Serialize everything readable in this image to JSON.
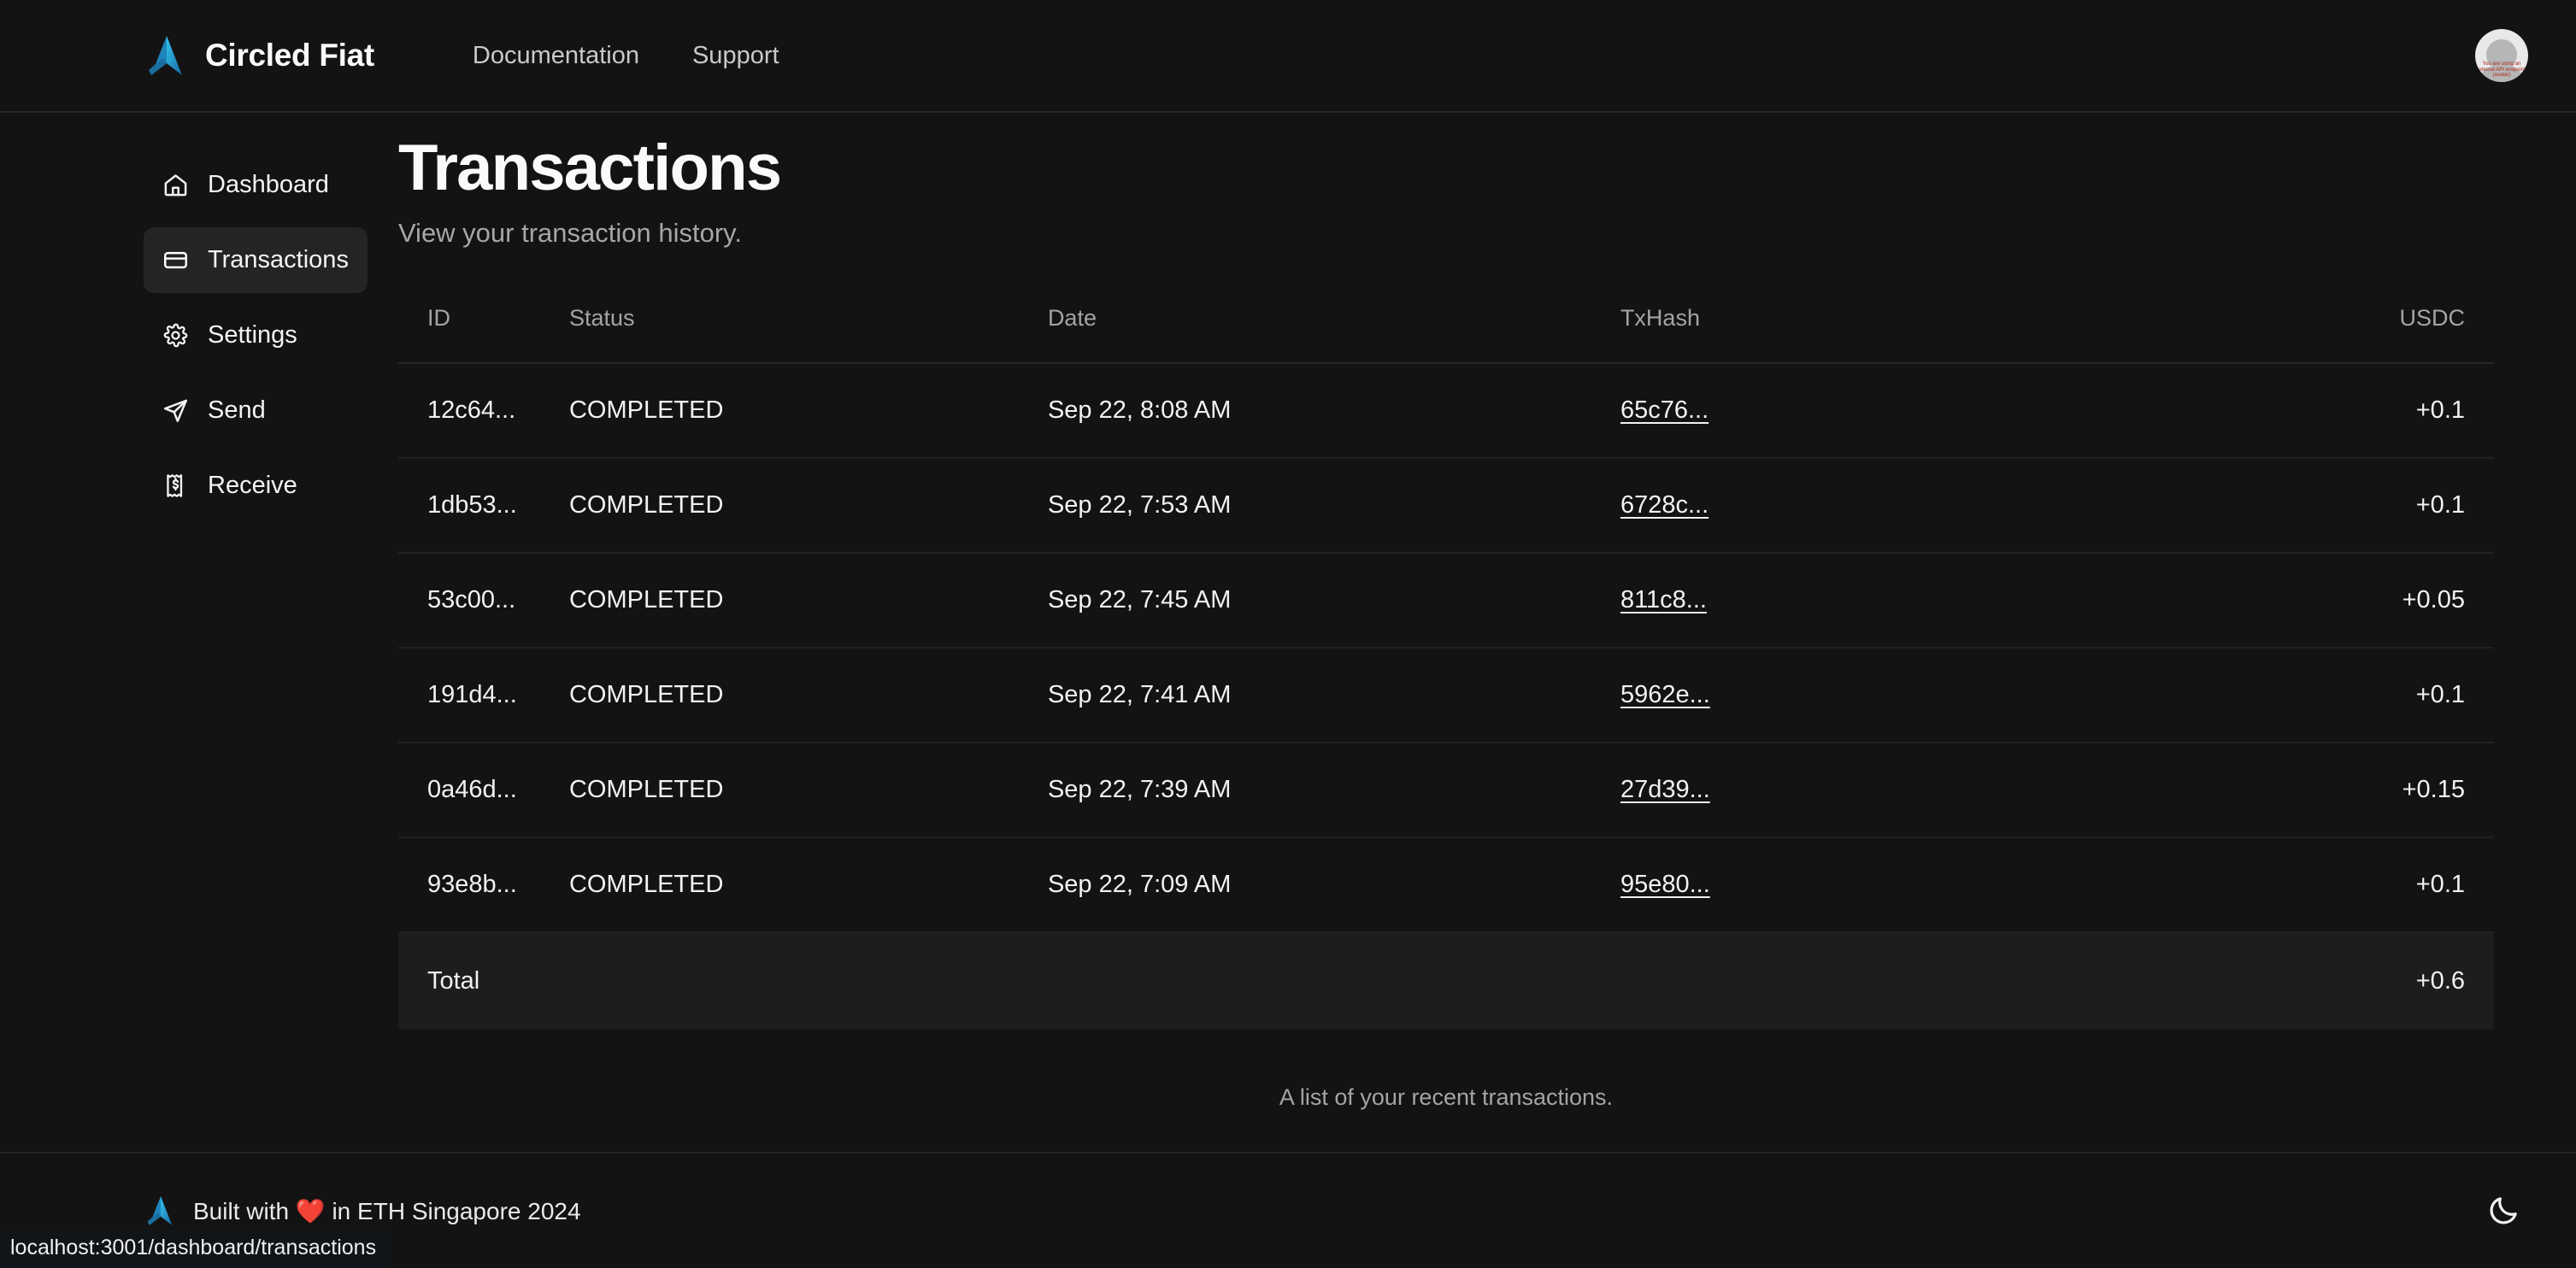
{
  "header": {
    "brand_name": "Circled Fiat",
    "logo_icon": "arrow-logo-icon",
    "nav": [
      {
        "label": "Documentation",
        "name": "nav-link-documentation"
      },
      {
        "label": "Support",
        "name": "nav-link-support"
      }
    ],
    "avatar": {
      "icon": "user-avatar-icon",
      "overlay_text": "You are using an external API endpoint. (avatar)"
    }
  },
  "sidebar": {
    "items": [
      {
        "label": "Dashboard",
        "icon": "home-icon",
        "active": false
      },
      {
        "label": "Transactions",
        "icon": "credit-card-icon",
        "active": true
      },
      {
        "label": "Settings",
        "icon": "gear-icon",
        "active": false
      },
      {
        "label": "Send",
        "icon": "send-icon",
        "active": false
      },
      {
        "label": "Receive",
        "icon": "receipt-icon",
        "active": false
      }
    ]
  },
  "main": {
    "title": "Transactions",
    "subtitle": "View your transaction history.",
    "table": {
      "columns": [
        "ID",
        "Status",
        "Date",
        "TxHash",
        "USDC"
      ],
      "rows": [
        {
          "id": "12c64...",
          "status": "COMPLETED",
          "date": "Sep 22, 8:08 AM",
          "txhash": "65c76...",
          "usdc": "+0.1"
        },
        {
          "id": "1db53...",
          "status": "COMPLETED",
          "date": "Sep 22, 7:53 AM",
          "txhash": "6728c...",
          "usdc": "+0.1"
        },
        {
          "id": "53c00...",
          "status": "COMPLETED",
          "date": "Sep 22, 7:45 AM",
          "txhash": "811c8...",
          "usdc": "+0.05"
        },
        {
          "id": "191d4...",
          "status": "COMPLETED",
          "date": "Sep 22, 7:41 AM",
          "txhash": "5962e...",
          "usdc": "+0.1"
        },
        {
          "id": "0a46d...",
          "status": "COMPLETED",
          "date": "Sep 22, 7:39 AM",
          "txhash": "27d39...",
          "usdc": "+0.15"
        },
        {
          "id": "93e8b...",
          "status": "COMPLETED",
          "date": "Sep 22, 7:09 AM",
          "txhash": "95e80...",
          "usdc": "+0.1"
        }
      ],
      "total_label": "Total",
      "total_value": "+0.6",
      "caption": "A list of your recent transactions."
    }
  },
  "footer": {
    "logo_icon": "arrow-logo-icon",
    "text_before": "Built with",
    "heart": "❤️",
    "text_after": "in ETH Singapore 2024",
    "full_text": "Built with ❤️ in ETH Singapore 2024",
    "theme_toggle_icon": "moon-icon"
  },
  "statusbar": {
    "url": "localhost:3001/dashboard/transactions"
  },
  "colors": {
    "page_bg": "#131313",
    "surface": "#1d1d1d",
    "border": "#262626",
    "text_primary": "#f2f2f2",
    "text_muted": "#a4a4a4",
    "brand_cyan": "#2bb8e6",
    "brand_blue": "#1b6e9c",
    "heart_red": "#e8413a"
  }
}
